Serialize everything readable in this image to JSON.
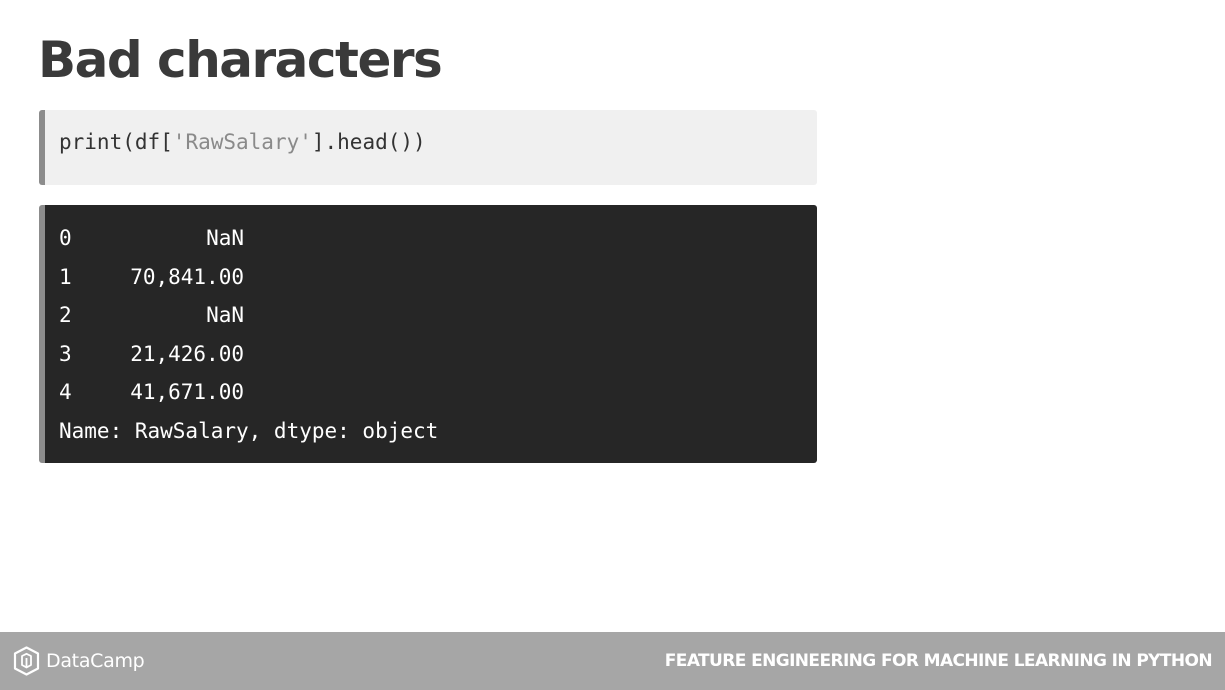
{
  "slide": {
    "title": "Bad characters"
  },
  "code": {
    "prefix": "print(df[",
    "string_arg": "'RawSalary'",
    "suffix": "].head())"
  },
  "output": {
    "rows": [
      {
        "index": "0",
        "value": "NaN"
      },
      {
        "index": "1",
        "value": "70,841.00"
      },
      {
        "index": "2",
        "value": "NaN"
      },
      {
        "index": "3",
        "value": "21,426.00"
      },
      {
        "index": "4",
        "value": "41,671.00"
      }
    ],
    "footer": "Name: RawSalary, dtype: object"
  },
  "footer": {
    "brand": "DataCamp",
    "brand_icon": "datacamp-logo-icon",
    "course_title": "FEATURE ENGINEERING FOR MACHINE LEARNING IN PYTHON"
  },
  "colors": {
    "code_background": "#f0f0f0",
    "output_background": "#262626",
    "accent_border": "#8c8c8c",
    "footer_background": "#a6a6a6",
    "title_text": "#3a3a3a"
  }
}
